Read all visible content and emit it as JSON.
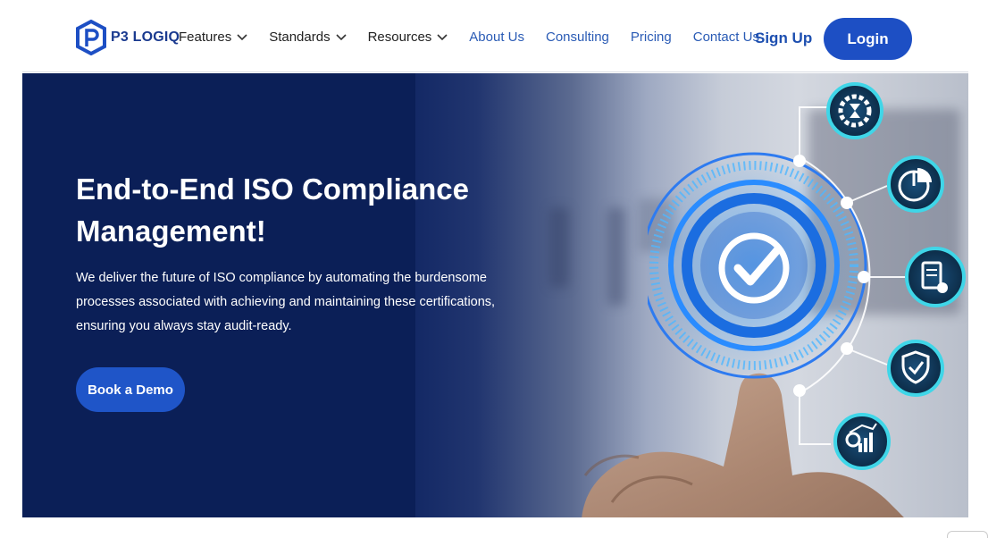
{
  "brand": {
    "name": "P3 LOGIQ"
  },
  "nav": {
    "dropdowns": [
      {
        "label": "Features"
      },
      {
        "label": "Standards"
      },
      {
        "label": "Resources"
      }
    ],
    "links": [
      {
        "label": "About Us"
      },
      {
        "label": "Consulting"
      },
      {
        "label": "Pricing"
      },
      {
        "label": "Contact Us"
      }
    ],
    "signup_label": "Sign Up",
    "login_label": "Login"
  },
  "hero": {
    "title": "End-to-End ISO Compliance Management!",
    "description": "We deliver the future of ISO compliance by automating the burdensome processes associated with achieving and maintaining these certifications, ensuring you always stay audit-ready.",
    "cta_label": "Book a Demo"
  },
  "graphic_icons": [
    "gear-hourglass-icon",
    "pie-chart-icon",
    "document-gear-icon",
    "shield-check-icon",
    "analytics-chart-icon",
    "checkmark-icon"
  ],
  "colors": {
    "brand": "#1d4fc4",
    "hero_bg": "#0b1f57",
    "accent_cyan": "#3fd6e8"
  }
}
